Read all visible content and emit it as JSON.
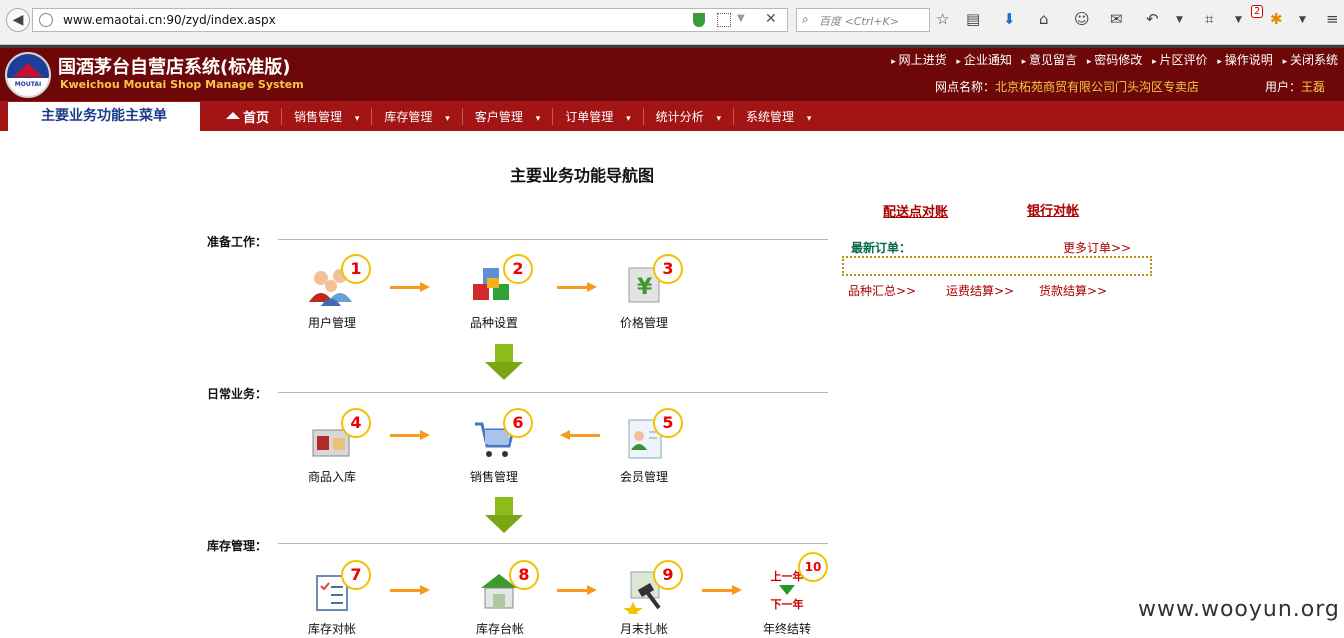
{
  "browser": {
    "url": "www.emaotai.cn:90/zyd/index.aspx",
    "search_placeholder": "百度 <Ctrl+K>",
    "badge_count": "2"
  },
  "header": {
    "title_cn": "国酒茅台自营店系统(标准版)",
    "title_en": "Kweichou Moutai Shop Manage System",
    "logo_text": "MOUTAI",
    "top_links": [
      "网上进货",
      "企业通知",
      "意见留言",
      "密码修改",
      "片区评价",
      "操作说明",
      "关闭系统"
    ],
    "outlet_label": "网点名称：",
    "outlet_value": "北京柘苑商贸有限公司门头沟区专卖店",
    "user_label": "用户：",
    "user_value": "王磊"
  },
  "menubar": {
    "main_tab": "主要业务功能主菜单",
    "home": "首页",
    "items": [
      "销售管理",
      "库存管理",
      "客户管理",
      "订单管理",
      "统计分析",
      "系统管理"
    ]
  },
  "main": {
    "nav_title": "主要业务功能导航图",
    "sections": [
      "准备工作：",
      "日常业务：",
      "库存管理："
    ],
    "nodes": [
      {
        "num": "1",
        "label": "用户管理"
      },
      {
        "num": "2",
        "label": "品种设置"
      },
      {
        "num": "3",
        "label": "价格管理"
      },
      {
        "num": "4",
        "label": "商品入库"
      },
      {
        "num": "6",
        "label": "销售管理"
      },
      {
        "num": "5",
        "label": "会员管理"
      },
      {
        "num": "7",
        "label": "库存对帐"
      },
      {
        "num": "8",
        "label": "库存台帐"
      },
      {
        "num": "9",
        "label": "月末扎帐"
      },
      {
        "num": "10",
        "label": "年终结转"
      }
    ],
    "year_prev": "上一年",
    "year_next": "下一年"
  },
  "right": {
    "link_delivery": "配送点对账",
    "link_bank": "银行对帐",
    "new_orders": "最新订单：",
    "more_orders": "更多订单>>",
    "sub_links": [
      "品种汇总>>",
      "运费结算>>",
      "货款结算>>"
    ]
  },
  "watermark": "www.wooyun.org"
}
